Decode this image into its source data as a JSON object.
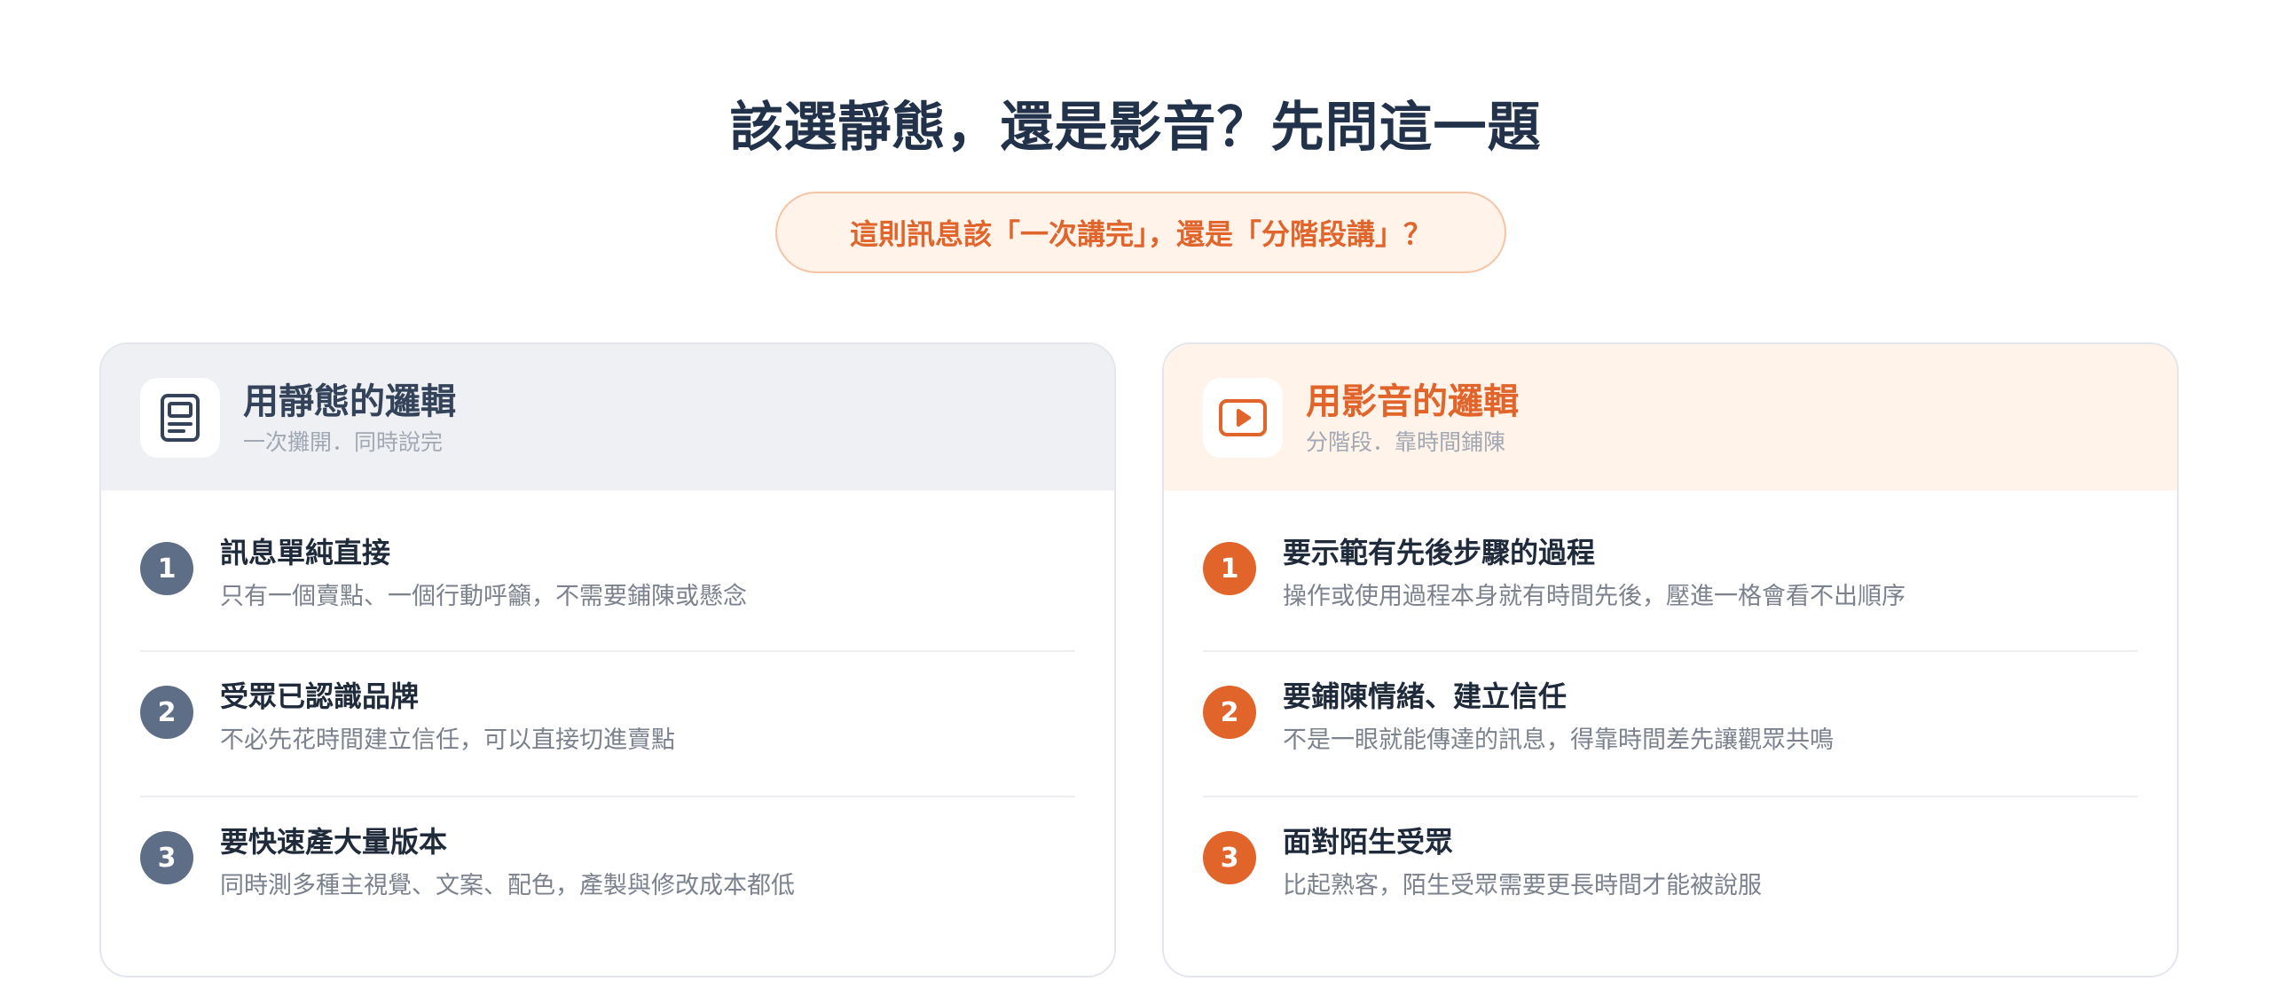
{
  "page": {
    "title": "該選靜態，還是影音？先問這一題",
    "question": "這則訊息該「一次講完」，還是「分階段講」？"
  },
  "colors": {
    "accent": "#e1642b",
    "slate": "#5d6e86",
    "title": "#22324a"
  },
  "static_card": {
    "icon": "document-icon",
    "title": "用靜態的邏輯",
    "subtitle": "一次攤開．同時說完",
    "items": [
      {
        "number": "1",
        "title": "訊息單純直接",
        "desc": "只有一個賣點、一個行動呼籲，不需要鋪陳或懸念"
      },
      {
        "number": "2",
        "title": "受眾已認識品牌",
        "desc": "不必先花時間建立信任，可以直接切進賣點"
      },
      {
        "number": "3",
        "title": "要快速產大量版本",
        "desc": "同時測多種主視覺、文案、配色，產製與修改成本都低"
      }
    ]
  },
  "video_card": {
    "icon": "play-icon",
    "title": "用影音的邏輯",
    "subtitle": "分階段．靠時間鋪陳",
    "items": [
      {
        "number": "1",
        "title": "要示範有先後步驟的過程",
        "desc": "操作或使用過程本身就有時間先後，壓進一格會看不出順序"
      },
      {
        "number": "2",
        "title": "要鋪陳情緒、建立信任",
        "desc": "不是一眼就能傳達的訊息，得靠時間差先讓觀眾共鳴"
      },
      {
        "number": "3",
        "title": "面對陌生受眾",
        "desc": "比起熟客，陌生受眾需要更長時間才能被說服"
      }
    ]
  }
}
